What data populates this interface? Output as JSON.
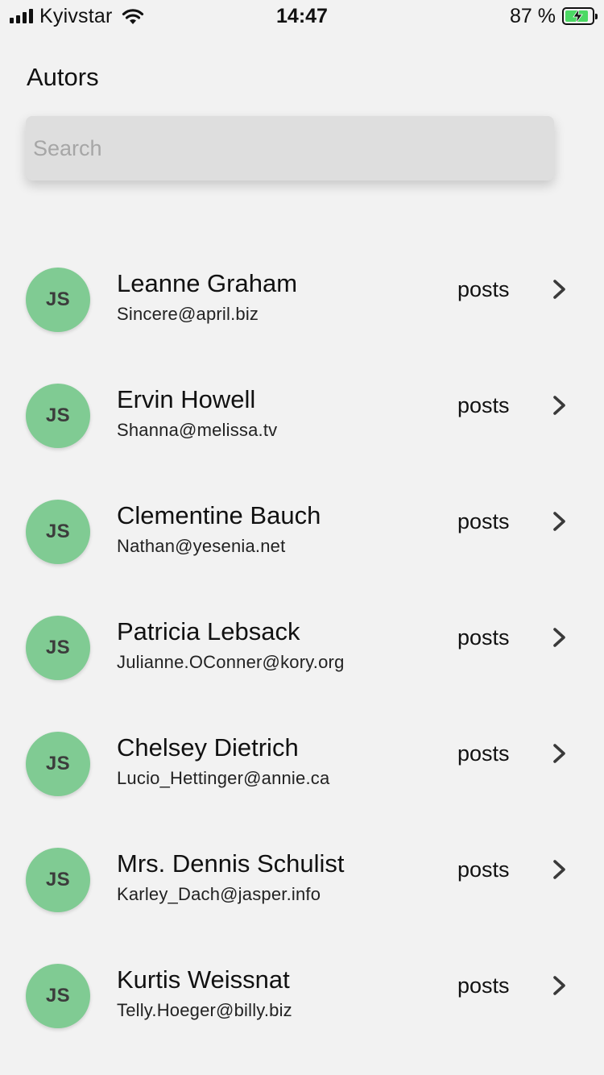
{
  "status_bar": {
    "carrier": "Kyivstar",
    "time": "14:47",
    "battery": "87 %",
    "battery_level": 0.87,
    "battery_charging_color": "#4cd964"
  },
  "header": {
    "title": "Autors"
  },
  "search": {
    "placeholder": "Search",
    "value": ""
  },
  "colors": {
    "background": "#f2f2f2",
    "avatar": "#80cb93",
    "search_bg": "#dedede"
  },
  "authors": [
    {
      "initials": "JS",
      "name": "Leanne Graham",
      "email": "Sincere@april.biz",
      "link_label": "posts"
    },
    {
      "initials": "JS",
      "name": "Ervin Howell",
      "email": "Shanna@melissa.tv",
      "link_label": "posts"
    },
    {
      "initials": "JS",
      "name": "Clementine Bauch",
      "email": "Nathan@yesenia.net",
      "link_label": "posts"
    },
    {
      "initials": "JS",
      "name": "Patricia Lebsack",
      "email": "Julianne.OConner@kory.org",
      "link_label": "posts"
    },
    {
      "initials": "JS",
      "name": "Chelsey Dietrich",
      "email": "Lucio_Hettinger@annie.ca",
      "link_label": "posts"
    },
    {
      "initials": "JS",
      "name": "Mrs. Dennis Schulist",
      "email": "Karley_Dach@jasper.info",
      "link_label": "posts"
    },
    {
      "initials": "JS",
      "name": "Kurtis Weissnat",
      "email": "Telly.Hoeger@billy.biz",
      "link_label": "posts"
    }
  ],
  "icons": {
    "signal": "cellular-signal-icon",
    "wifi": "wifi-icon",
    "battery": "battery-icon",
    "chevron": "chevron-right-icon"
  }
}
